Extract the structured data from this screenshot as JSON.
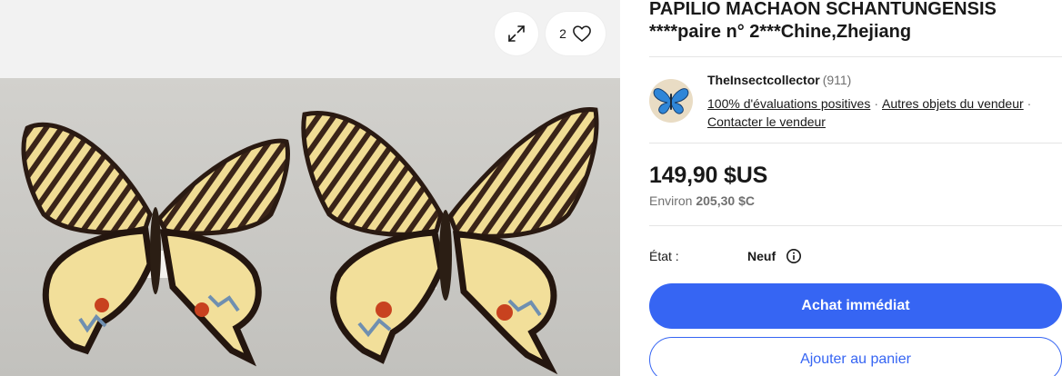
{
  "gallery": {
    "image_count": "2",
    "expand_icon": "expand-arrows-icon",
    "favorite_icon": "heart-icon"
  },
  "listing": {
    "title_line1": "PAPILIO MACHAON SCHANTUNGENSIS",
    "title_line2": "****paire n° 2***Chine,Zhejiang"
  },
  "seller": {
    "name": "TheInsectcollector",
    "feedback_count": "(911)",
    "positive_rating": "100% d'évaluations positives",
    "other_items": "Autres objets du vendeur",
    "contact": "Contacter le vendeur",
    "separator": "·"
  },
  "price": {
    "amount": "149,90 $US",
    "approx_label": "Environ",
    "approx_amount": "205,30 $C"
  },
  "condition": {
    "label": "État :",
    "value": "Neuf"
  },
  "actions": {
    "buy_now": "Achat immédiat",
    "add_to_cart": "Ajouter au panier"
  },
  "colors": {
    "primary_blue": "#3665f3",
    "text": "#191919",
    "muted": "#707070"
  }
}
